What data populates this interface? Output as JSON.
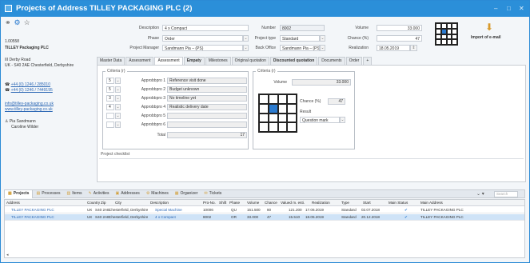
{
  "window": {
    "title": "Projects of Address TILLEY PACKAGING PLC (2)",
    "controls": [
      "–",
      "□",
      "✕"
    ]
  },
  "toolbar_icons": [
    "paperclip-icon",
    "settings-icon",
    "star-icon"
  ],
  "address": {
    "number": "1.00558",
    "company": "TILLEY Packaging PLC",
    "street": "III Derby Road",
    "city": "UK - S40 2AE Chesterfield, Derbyshire",
    "phone1": "+44 (0) 1246 / 285010",
    "phone2": "+44 (0) 1246 / 7449195",
    "email": "info@tilley-packaging.co.uk",
    "web": "www.tilley-packaging.co.uk",
    "contact1": "Pia Sandmann",
    "contact2": "Caroline Wilder"
  },
  "header_fields": {
    "description_label": "Description",
    "description": "4 x Compact",
    "phase_label": "Phase",
    "phase": "Order",
    "pm_label": "Project Manager",
    "pm": "Sandmann Pia – (PS)",
    "number_label": "Number",
    "number": "8002",
    "ptype_label": "Project type",
    "ptype": "Standard",
    "backoffice_label": "Back Office",
    "backoffice": "Sandmann Pia – (PS)",
    "volume_label": "Volume",
    "volume": "33.000",
    "chance_label": "Chance (%)",
    "chance": "47",
    "realization_label": "Realization",
    "realization": "18.05.2019"
  },
  "import_email_label": "Import of e-mail",
  "tabs": [
    "Master Data",
    "Assessment",
    "Assessment",
    "Empaty",
    "Milestones",
    "Original quotation",
    "Discounted quotation",
    "Documents",
    "Order",
    "+"
  ],
  "criteria": {
    "title": "Criteria (r)",
    "rows": [
      {
        "score": "5",
        "label": "Approbbpro 1",
        "value": "Reference visit done"
      },
      {
        "score": "5",
        "label": "Approbbpro 2",
        "value": "Budget unknown"
      },
      {
        "score": "3",
        "label": "Approbbpro 3",
        "value": "No timeline yet"
      },
      {
        "score": "4",
        "label": "Approbbpro 4",
        "value": "Realistic delivery date"
      },
      {
        "score": "",
        "label": "Approbbpro 5",
        "value": ""
      },
      {
        "score": "",
        "label": "Approbbpro 6",
        "value": ""
      }
    ],
    "total_label": "Total",
    "total": "17"
  },
  "criteria2": {
    "title": "Criteria (r)",
    "volume_label": "Volume",
    "volume": "33.000",
    "chance_label": "Chance (%)",
    "chance": "47",
    "result_label": "Result",
    "result": "Question mark"
  },
  "project_checklist_label": "Project checklist",
  "bottom_tabs": [
    {
      "label": "Projects",
      "active": true
    },
    {
      "label": "Processes"
    },
    {
      "label": "Items"
    },
    {
      "label": "Activities"
    },
    {
      "label": "Addresses"
    },
    {
      "label": "Machines"
    },
    {
      "label": "Organizer"
    },
    {
      "label": "Tickets"
    }
  ],
  "grid": {
    "headers": [
      "Address",
      "Country",
      "Zip",
      "City",
      "Description",
      "Pro-No.",
      "Shift",
      "Phase",
      "Volume",
      "Chance",
      "Valued m. esti.",
      "Realization",
      "Type",
      "Start",
      "Main Status",
      "Main Address"
    ],
    "rows": [
      [
        "TILLEY PACKAGING PLC",
        "UK",
        "S40 2AE",
        "Chesterfield, Derbyshire",
        "Special Machine",
        "10006",
        "",
        "QU",
        "151.500",
        "80",
        "121.200",
        "17.06.2019",
        "Standard",
        "02.07.2018",
        "✔",
        "TILLEY PACKAGING PLC"
      ],
      [
        "TILLEY PACKAGING PLC",
        "UK",
        "S40 2AE",
        "Chesterfield, Derbyshire",
        "4 x Compact",
        "8002",
        "",
        "OR",
        "33.000",
        "47",
        "15.510",
        "18.05.2019",
        "Standard",
        "20.12.2018",
        "✔",
        "TILLEY PACKAGING PLC"
      ]
    ]
  },
  "search_placeholder": "Search",
  "colors": {
    "titlebar": "#2b8fd9",
    "accent": "#2b7bd0"
  }
}
